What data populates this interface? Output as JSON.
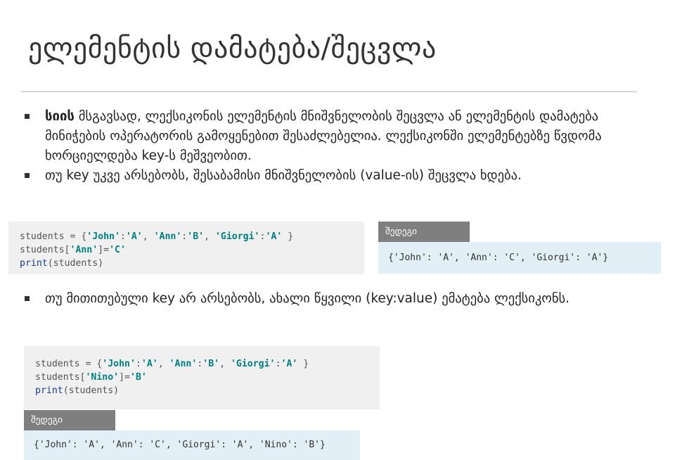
{
  "title": "ელემენტის დამატება/შეცვლა",
  "bullet1": {
    "bold_word": "სიის",
    "rest": " მსგავსად, ლექსიკონის ელემენტის მნიშვნელობის შეცვლა ან ელემენტის დამატება მინიჭების ოპერატორის გამოყენებით შესაძლებელია. ლექსიკონში ელემენტებზე წვდომა ხორციელდება key-ს მეშვეობით."
  },
  "bullet2": "თუ key უკვე არსებობს, შესაბამისი მნიშვნელობის (value-ის) შეცვლა ხდება.",
  "code1": {
    "l1_a": "students = {",
    "l1_s1": "'John'",
    "l1_c1": ":",
    "l1_s2": "'A'",
    "l1_c2": ", ",
    "l1_s3": "'Ann'",
    "l1_c3": ":",
    "l1_s4": "'B'",
    "l1_c4": ", ",
    "l1_s5": "'Giorgi'",
    "l1_c5": ":",
    "l1_s6": "'A'",
    "l1_c6": " }",
    "l2_a": "students[",
    "l2_s1": "'Ann'",
    "l2_b": "]=",
    "l2_s2": "'C'",
    "l3_kw": "print",
    "l3_rest": "(students)"
  },
  "result1": {
    "label": "შედეგი",
    "output": "{'John': 'A', 'Ann': 'C', 'Giorgi': 'A'}"
  },
  "bullet3": "თუ მითითებული key არ არსებობს, ახალი წყვილი (key:value) ემატება ლექსიკონს.",
  "code2": {
    "l1_a": "students = {",
    "l1_s1": "'John'",
    "l1_c1": ":",
    "l1_s2": "'A'",
    "l1_c2": ", ",
    "l1_s3": "'Ann'",
    "l1_c3": ":",
    "l1_s4": "'B'",
    "l1_c4": ", ",
    "l1_s5": "'Giorgi'",
    "l1_c5": ":",
    "l1_s6": "'A'",
    "l1_c6": " }",
    "l2_a": "students[",
    "l2_s1": "'Nino'",
    "l2_b": "]=",
    "l2_s2": "'B'",
    "l3_kw": "print",
    "l3_rest": "(students)"
  },
  "result2": {
    "label": "შედეგი",
    "output": "{'John': 'A', 'Ann': 'C', 'Giorgi': 'A', 'Nino': 'B'}"
  },
  "colors": {
    "string": "#008080",
    "keyword": "#1a3a9a",
    "code_bg": "#f0f0f0",
    "result_label_bg": "#7f7f7f",
    "result_bg": "#e2eff7"
  }
}
